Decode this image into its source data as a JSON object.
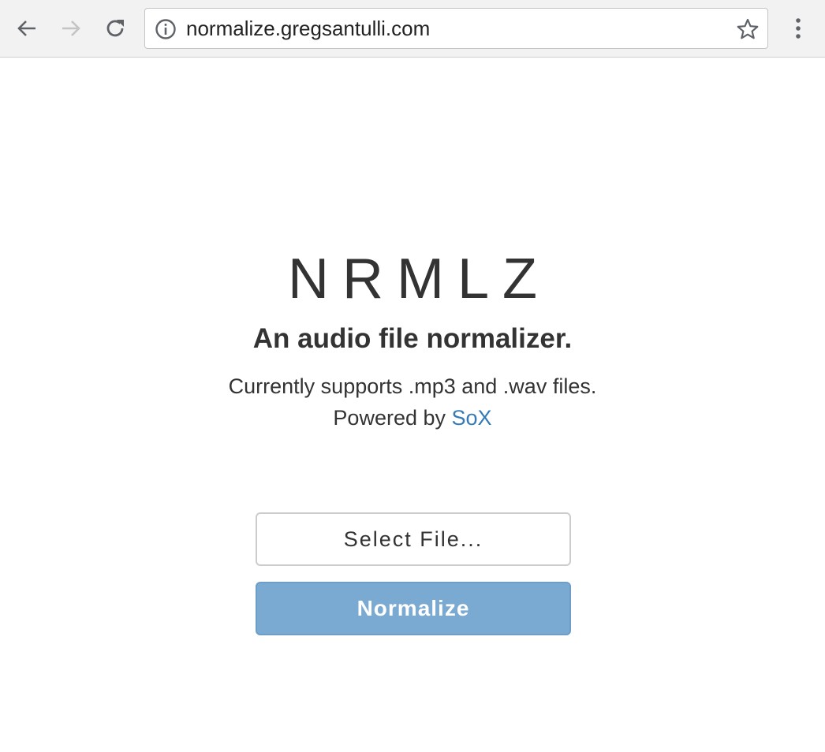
{
  "browser": {
    "url": "normalize.gregsantulli.com",
    "icons": {
      "back": "arrow-left-icon",
      "forward": "arrow-right-icon",
      "reload": "reload-icon",
      "info": "info-circle-icon",
      "bookmark": "star-outline-icon",
      "menu": "vertical-dots-icon"
    }
  },
  "page": {
    "logo": "NRMLZ",
    "subtitle": "An audio file normalizer.",
    "supports_text": "Currently supports .mp3 and .wav files.",
    "powered_prefix": "Powered by",
    "powered_link": "SoX",
    "select_button_label": "Select File...",
    "normalize_button_label": "Normalize"
  },
  "colors": {
    "link": "#337ab7",
    "normalize_button": "#7aa9d2",
    "text": "#333333"
  }
}
